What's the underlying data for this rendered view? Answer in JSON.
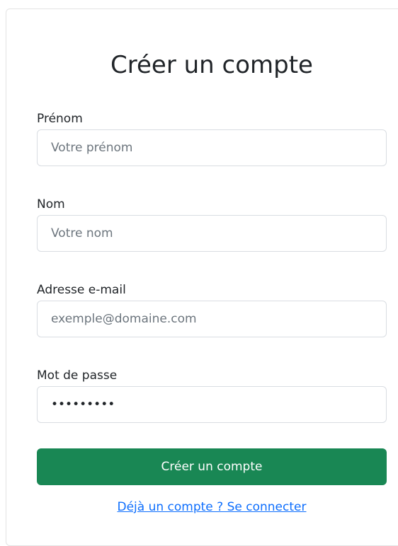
{
  "form": {
    "title": "Créer un compte",
    "fields": [
      {
        "label": "Prénom",
        "placeholder": "Votre prénom",
        "value": "",
        "type": "text"
      },
      {
        "label": "Nom",
        "placeholder": "Votre nom",
        "value": "",
        "type": "text"
      },
      {
        "label": "Adresse e-mail",
        "placeholder": "exemple@domaine.com",
        "value": "",
        "type": "email"
      },
      {
        "label": "Mot de passe",
        "placeholder": "",
        "value": "•••••••••",
        "type": "password"
      }
    ],
    "submit_label": "Créer un compte",
    "login_link": "Déjà un compte ? Se connecter"
  },
  "colors": {
    "primary_button": "#198754",
    "link": "#0d6efd",
    "input_border": "#d9dde2",
    "text": "#212529",
    "placeholder": "#6c757d"
  }
}
